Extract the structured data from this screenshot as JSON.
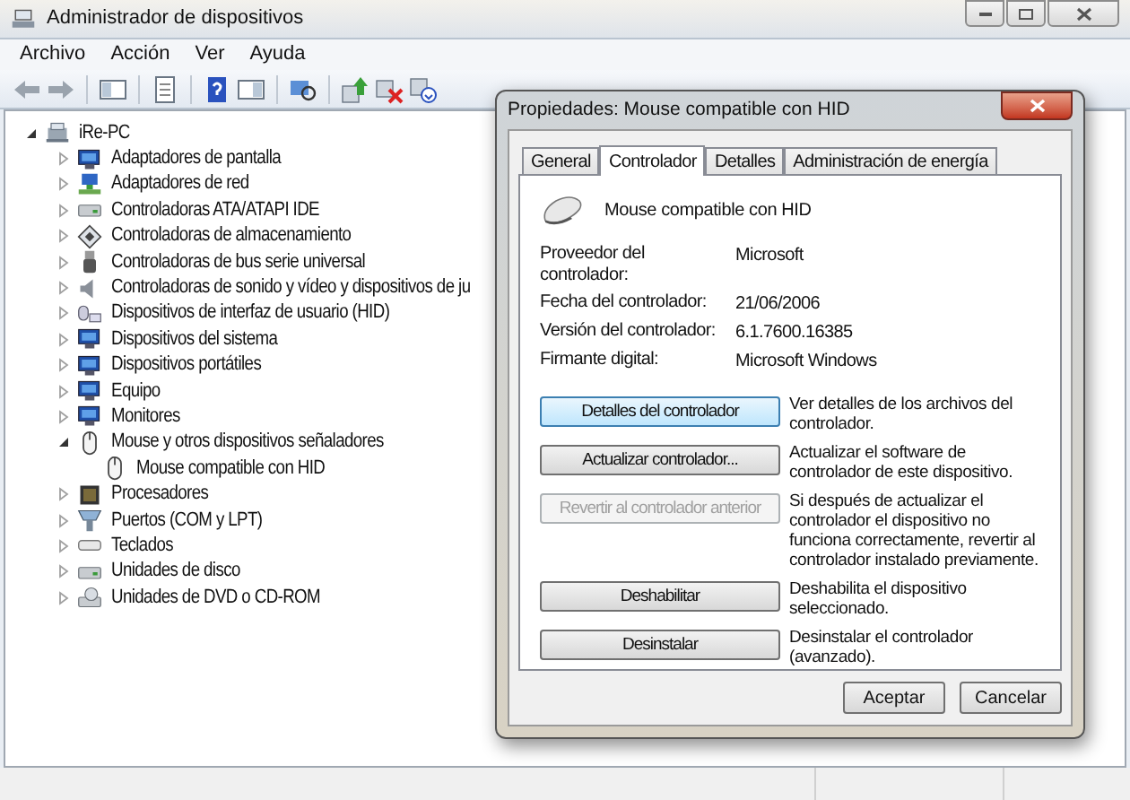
{
  "window": {
    "title": "Administrador de dispositivos"
  },
  "menu": [
    "Archivo",
    "Acción",
    "Ver",
    "Ayuda"
  ],
  "tree": {
    "label": "iRe-PC",
    "kind": "computer",
    "expanded": true,
    "children": [
      {
        "label": "Adaptadores de pantalla",
        "kind": "monitor",
        "expanded": false
      },
      {
        "label": "Adaptadores de red",
        "kind": "network",
        "expanded": false
      },
      {
        "label": "Controladoras ATA/ATAPI IDE",
        "kind": "drive",
        "expanded": false
      },
      {
        "label": "Controladoras de almacenamiento",
        "kind": "storage",
        "expanded": false
      },
      {
        "label": "Controladoras de bus serie universal",
        "kind": "usb",
        "expanded": false
      },
      {
        "label": "Controladoras de sonido y vídeo y dispositivos de ju",
        "kind": "speaker",
        "expanded": false
      },
      {
        "label": "Dispositivos de interfaz de usuario (HID)",
        "kind": "hid",
        "expanded": false
      },
      {
        "label": "Dispositivos del sistema",
        "kind": "monitor",
        "expanded": false
      },
      {
        "label": "Dispositivos portátiles",
        "kind": "monitor",
        "expanded": false
      },
      {
        "label": "Equipo",
        "kind": "monitor",
        "expanded": false
      },
      {
        "label": "Monitores",
        "kind": "monitor",
        "expanded": false
      },
      {
        "label": "Mouse y otros dispositivos señaladores",
        "kind": "mouse",
        "expanded": true,
        "children": [
          {
            "label": "Mouse compatible con HID",
            "kind": "mouse"
          }
        ]
      },
      {
        "label": "Procesadores",
        "kind": "chip",
        "expanded": false
      },
      {
        "label": "Puertos (COM y LPT)",
        "kind": "port",
        "expanded": false
      },
      {
        "label": "Teclados",
        "kind": "keyboard",
        "expanded": false
      },
      {
        "label": "Unidades de disco",
        "kind": "drive",
        "expanded": false
      },
      {
        "label": "Unidades de DVD o CD-ROM",
        "kind": "dvd",
        "expanded": false
      }
    ]
  },
  "dialog": {
    "title": "Propiedades: Mouse compatible con HID",
    "tabs": [
      {
        "label": "General",
        "selected": false
      },
      {
        "label": "Controlador",
        "selected": true
      },
      {
        "label": "Detalles",
        "selected": false
      },
      {
        "label": "Administración de energía",
        "selected": false
      }
    ],
    "device_name": "Mouse compatible con HID",
    "properties": [
      {
        "label": "Proveedor del controlador:",
        "value": "Microsoft"
      },
      {
        "label": "Fecha del controlador:",
        "value": "21/06/2006"
      },
      {
        "label": "Versión del controlador:",
        "value": "6.1.7600.16385"
      },
      {
        "label": "Firmante digital:",
        "value": "Microsoft Windows"
      }
    ],
    "actions": [
      {
        "button": "Detalles del controlador",
        "description": "Ver detalles de los archivos del controlador.",
        "disabled": false,
        "focused": true
      },
      {
        "button": "Actualizar controlador...",
        "description": "Actualizar el software de controlador de este dispositivo.",
        "disabled": false,
        "focused": false
      },
      {
        "button": "Revertir al controlador anterior",
        "description": "Si después de actualizar el controlador el dispositivo no funciona correctamente, revertir al controlador instalado previamente.",
        "disabled": true,
        "focused": false
      },
      {
        "button": "Deshabilitar",
        "description": "Deshabilita el dispositivo seleccionado.",
        "disabled": false,
        "focused": false
      },
      {
        "button": "Desinstalar",
        "description": "Desinstalar el controlador (avanzado).",
        "disabled": false,
        "focused": false
      }
    ],
    "buttons": [
      "Aceptar",
      "Cancelar"
    ]
  }
}
